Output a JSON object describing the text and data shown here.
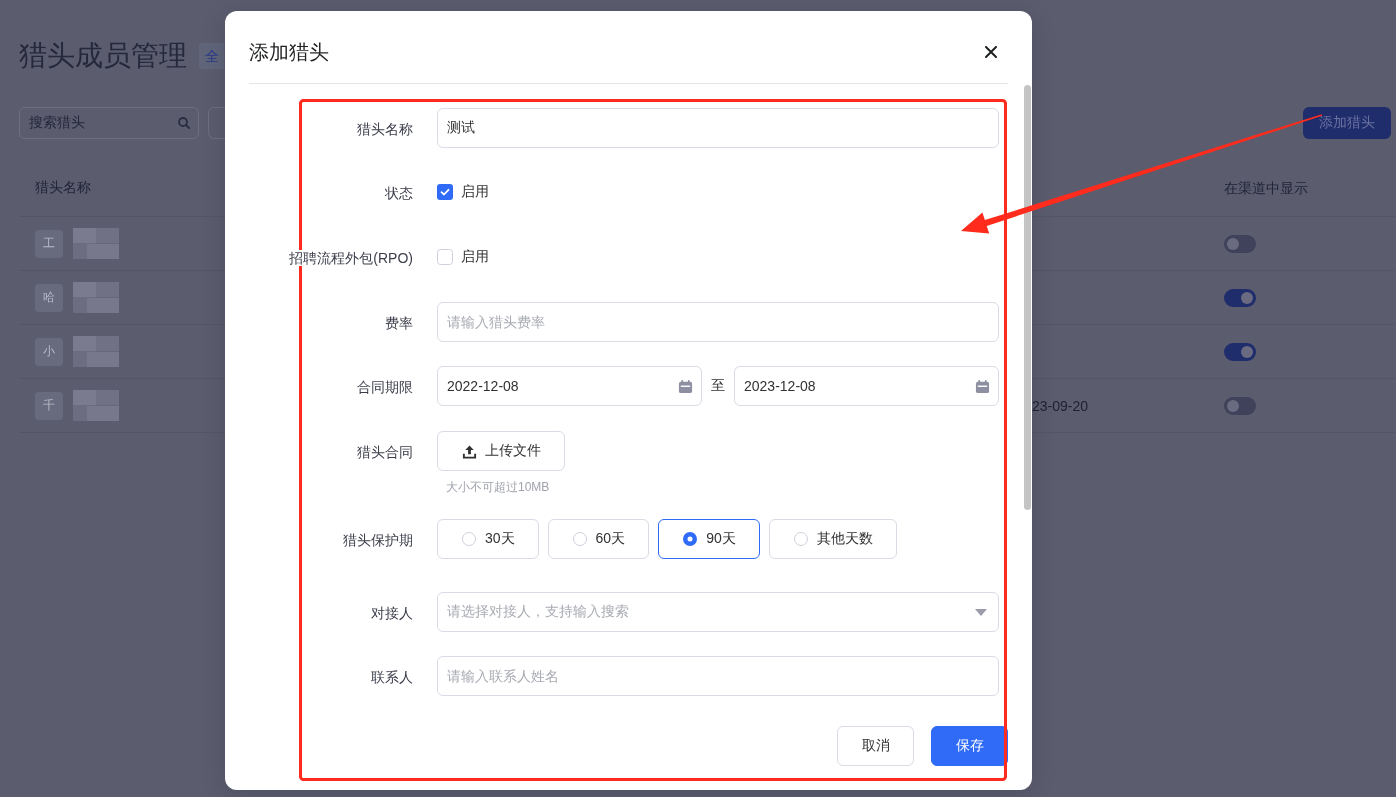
{
  "page": {
    "title": "猎头成员管理",
    "tag": "全",
    "search": {
      "placeholder": "搜索猎头"
    },
    "add_button": "添加猎头",
    "table": {
      "columns": [
        "猎头名称",
        "在渠道中显示"
      ],
      "rows": [
        {
          "avatar": "工",
          "on": false
        },
        {
          "avatar": "哈",
          "on": true
        },
        {
          "avatar": "小",
          "on": true
        },
        {
          "avatar": "千",
          "date": "23-09-20",
          "on": false
        }
      ]
    }
  },
  "dialog": {
    "title": "添加猎头",
    "fields": [
      {
        "kind": "text",
        "label": "猎头名称",
        "value": "测试"
      },
      {
        "kind": "checkbox",
        "label": "状态",
        "option": "启用",
        "checked": true
      },
      {
        "kind": "checkbox",
        "label": "招聘流程外包(RPO)",
        "option": "启用",
        "checked": false
      },
      {
        "kind": "text",
        "label": "费率",
        "placeholder": "请输入猎头费率"
      },
      {
        "kind": "date_range",
        "label": "合同期限",
        "start": "2022-12-08",
        "separator": "至",
        "end": "2023-12-08"
      },
      {
        "kind": "upload",
        "label": "猎头合同",
        "button": "上传文件",
        "hint": "大小不可超过10MB"
      },
      {
        "kind": "radio",
        "label": "猎头保护期",
        "options": [
          {
            "label": "30天",
            "selected": false
          },
          {
            "label": "60天",
            "selected": false
          },
          {
            "label": "90天",
            "selected": true
          },
          {
            "label": "其他天数",
            "selected": false
          }
        ]
      },
      {
        "kind": "select",
        "label": "对接人",
        "placeholder": "请选择对接人，支持输入搜索"
      },
      {
        "kind": "text",
        "label": "联系人",
        "placeholder": "请输入联系人姓名"
      }
    ],
    "buttons": [
      {
        "kind": "secondary",
        "label": "取消"
      },
      {
        "kind": "primary",
        "label": "保存"
      }
    ]
  }
}
